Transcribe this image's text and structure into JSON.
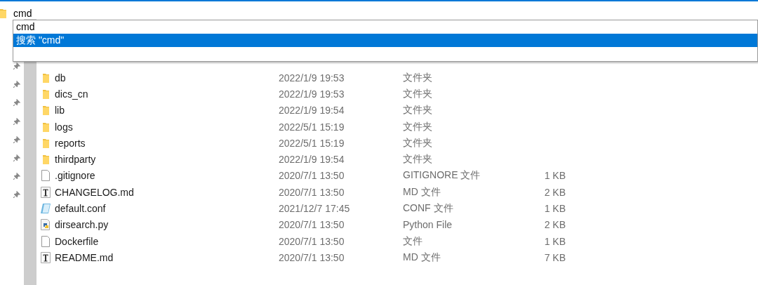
{
  "address_bar": {
    "value": "cmd"
  },
  "suggestions": [
    {
      "label": "cmd",
      "selected": false
    },
    {
      "label": "搜索 \"cmd\"",
      "selected": true
    }
  ],
  "quick_access": [
    {
      "pinned": true
    },
    {
      "pinned": true
    },
    {
      "pinned": true
    },
    {
      "pinned": true
    },
    {
      "pinned": true
    },
    {
      "pinned": true
    },
    {
      "pinned": true
    },
    {
      "pinned": true
    }
  ],
  "files": [
    {
      "kind": "folder",
      "name": "db",
      "date": "2022/1/9 19:53",
      "type": "文件夹"
    },
    {
      "kind": "folder",
      "name": "dics_cn",
      "date": "2022/1/9 19:53",
      "type": "文件夹"
    },
    {
      "kind": "folder",
      "name": "lib",
      "date": "2022/1/9 19:54",
      "type": "文件夹"
    },
    {
      "kind": "folder",
      "name": "logs",
      "date": "2022/5/1 15:19",
      "type": "文件夹"
    },
    {
      "kind": "folder",
      "name": "reports",
      "date": "2022/5/1 15:19",
      "type": "文件夹"
    },
    {
      "kind": "folder",
      "name": "thirdparty",
      "date": "2022/1/9 19:54",
      "type": "文件夹"
    },
    {
      "kind": "file",
      "name": ".gitignore",
      "date": "2020/7/1 13:50",
      "type": "GITIGNORE 文件",
      "size": "1 KB"
    },
    {
      "kind": "text",
      "name": "CHANGELOG.md",
      "date": "2020/7/1 13:50",
      "type": "MD 文件",
      "size": "2 KB"
    },
    {
      "kind": "config",
      "name": "default.conf",
      "date": "2021/12/7 17:45",
      "type": "CONF 文件",
      "size": "1 KB"
    },
    {
      "kind": "python",
      "name": "dirsearch.py",
      "date": "2020/7/1 13:50",
      "type": "Python File",
      "size": "2 KB"
    },
    {
      "kind": "file",
      "name": "Dockerfile",
      "date": "2020/7/1 13:50",
      "type": "文件",
      "size": "1 KB"
    },
    {
      "kind": "text",
      "name": "README.md",
      "date": "2020/7/1 13:50",
      "type": "MD 文件",
      "size": "7 KB"
    }
  ]
}
